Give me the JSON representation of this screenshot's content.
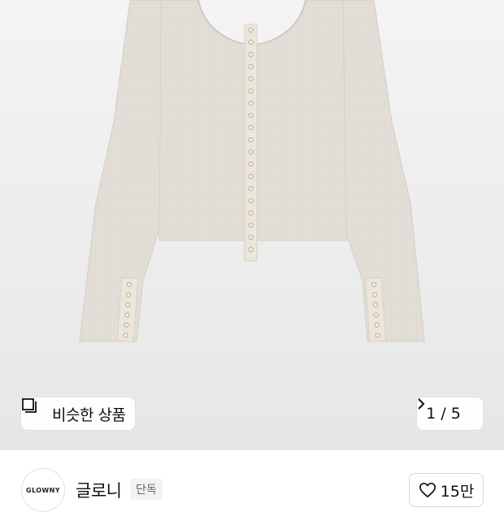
{
  "gallery": {
    "similar_label": "비슷한 상품",
    "page_indicator": "1 / 5"
  },
  "brand": {
    "logo_text": "GLOWNY",
    "name": "글로니",
    "badge": "단독"
  },
  "likes": {
    "count": "15만"
  },
  "colors": {
    "garment": "#e2ded7",
    "placket": "#ece6da",
    "background": "#f0f0f0"
  }
}
